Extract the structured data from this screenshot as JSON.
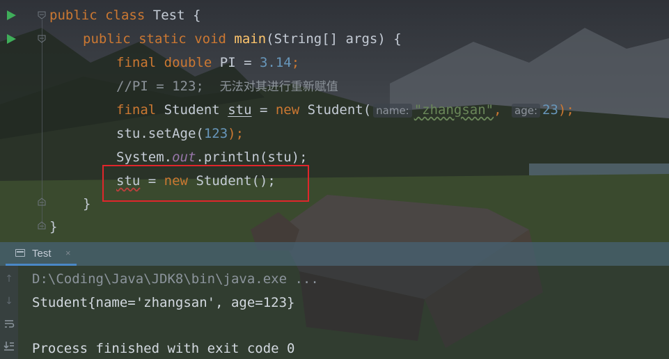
{
  "editor": {
    "lines": {
      "l1": {
        "kw1": "public",
        "kw2": "class",
        "name": "Test",
        "brace": "{"
      },
      "l2": {
        "kw1": "public",
        "kw2": "static",
        "kw3": "void",
        "method": "main",
        "params": "(String[] args) {"
      },
      "l3": {
        "kw1": "final",
        "kw2": "double",
        "name": "PI = ",
        "num": "3.14",
        "end": ";"
      },
      "l4": {
        "comment": "//PI = 123;",
        "comment_cn": "无法对其进行重新赋值"
      },
      "l5": {
        "kw1": "final",
        "type": "Student",
        "var": "stu",
        "eq": " = ",
        "kw2": "new",
        "ctor": "Student(",
        "hint_name": "name:",
        "str": "\"zhangsan\"",
        "comma": ",",
        "hint_age": "age:",
        "num": "23",
        "end": ");"
      },
      "l6": {
        "call": "stu.setAge(",
        "num": "123",
        "end": ");"
      },
      "l7": {
        "obj": "System.",
        "field": "out",
        "call": ".println(stu);"
      },
      "l8": {
        "var": "stu",
        "eq": " = ",
        "kw": "new",
        "ctor": "Student();"
      },
      "l9": {
        "brace": "}"
      },
      "l10": {
        "brace": "}"
      }
    },
    "error_highlight_color": "#e0262b"
  },
  "run_panel": {
    "tab_label": "Test",
    "tab_close": "×",
    "console": [
      "D:\\Coding\\Java\\JDK8\\bin\\java.exe ...",
      "Student{name='zhangsan', age=123}",
      "Process finished with exit code 0"
    ],
    "toolbar_icons": [
      "arrow-up-icon",
      "arrow-down-icon",
      "soft-wrap-icon",
      "scroll-to-end-icon"
    ]
  },
  "colors": {
    "keyword": "#cc7832",
    "method": "#ffc66d",
    "number": "#6897bb",
    "string": "#6a8759",
    "comment": "#8c939a",
    "run_icon": "#3fae5a"
  }
}
